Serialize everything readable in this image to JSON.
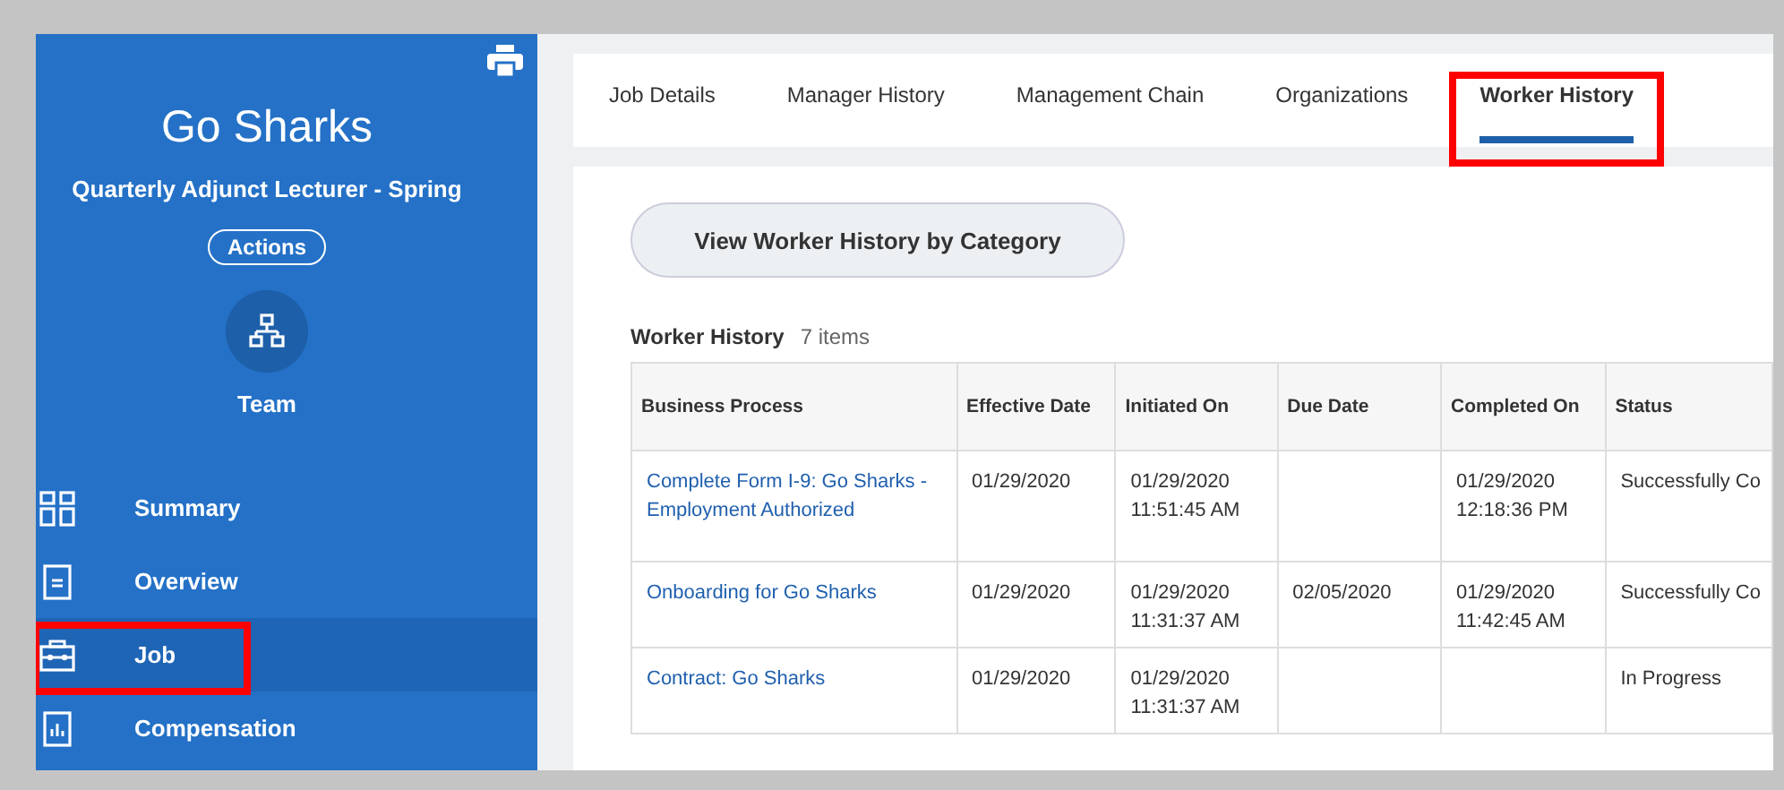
{
  "sidebar": {
    "title": "Go Sharks",
    "subtitle": "Quarterly Adjunct Lecturer - Spring",
    "actions_button": "Actions",
    "team_label": "Team",
    "items": [
      {
        "label": "Summary",
        "selected": false,
        "highlighted": false
      },
      {
        "label": "Overview",
        "selected": false,
        "highlighted": false
      },
      {
        "label": "Job",
        "selected": true,
        "highlighted": true
      },
      {
        "label": "Compensation",
        "selected": false,
        "highlighted": false
      }
    ]
  },
  "tabs": [
    {
      "label": "Job Details",
      "selected": false,
      "highlighted": false
    },
    {
      "label": "Manager History",
      "selected": false,
      "highlighted": false
    },
    {
      "label": "Management Chain",
      "selected": false,
      "highlighted": false
    },
    {
      "label": "Organizations",
      "selected": false,
      "highlighted": false
    },
    {
      "label": "Worker History",
      "selected": true,
      "highlighted": true
    }
  ],
  "category_button": "View Worker History by Category",
  "table": {
    "title": "Worker History",
    "count": "7 items",
    "columns": [
      "Business Process",
      "Effective Date",
      "Initiated On",
      "Due Date",
      "Completed On",
      "Status"
    ],
    "rows": [
      [
        "Complete Form I-9: Go Sharks - Employment Authorized",
        "01/29/2020",
        "01/29/2020 11:51:45 AM",
        "",
        "01/29/2020 12:18:36 PM",
        "Successfully Co"
      ],
      [
        "Onboarding for Go Sharks",
        "01/29/2020",
        "01/29/2020 11:31:37 AM",
        "02/05/2020",
        "01/29/2020 11:42:45 AM",
        "Successfully Co"
      ],
      [
        "Contract: Go Sharks",
        "01/29/2020",
        "01/29/2020 11:31:37 AM",
        "",
        "",
        "In Progress"
      ]
    ]
  }
}
